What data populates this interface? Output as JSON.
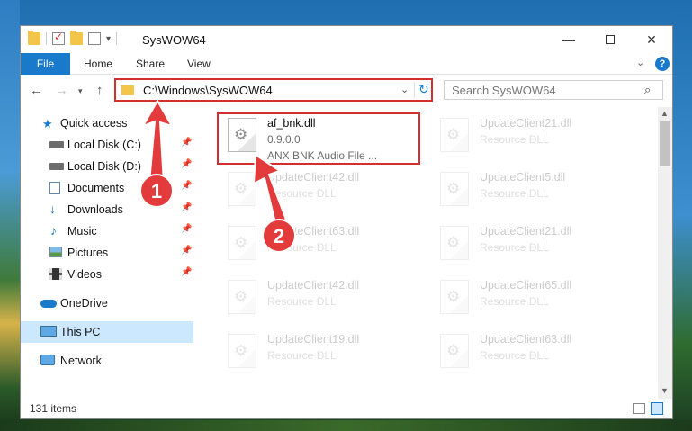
{
  "window": {
    "title": "SysWOW64",
    "controls": {
      "minimize": "—",
      "maximize": "",
      "close": "✕"
    }
  },
  "ribbon": {
    "tabs": [
      "File",
      "Home",
      "Share",
      "View"
    ],
    "help": "?"
  },
  "address": {
    "path": "C:\\Windows\\SysWOW64",
    "search_placeholder": "Search SysWOW64"
  },
  "sidebar": {
    "items": [
      {
        "label": "Quick access",
        "icon": "star-icon"
      },
      {
        "label": "Local Disk (C:)",
        "icon": "drive-icon",
        "pinned": true
      },
      {
        "label": "Local Disk (D:)",
        "icon": "drive-icon",
        "pinned": true
      },
      {
        "label": "Documents",
        "icon": "documents-icon",
        "pinned": true
      },
      {
        "label": "Downloads",
        "icon": "download-icon",
        "pinned": true
      },
      {
        "label": "Music",
        "icon": "music-icon",
        "pinned": true
      },
      {
        "label": "Pictures",
        "icon": "pictures-icon",
        "pinned": true
      },
      {
        "label": "Videos",
        "icon": "videos-icon",
        "pinned": true
      },
      {
        "label": "OneDrive",
        "icon": "cloud-icon"
      },
      {
        "label": "This PC",
        "icon": "computer-icon",
        "selected": true
      },
      {
        "label": "Network",
        "icon": "network-icon"
      }
    ]
  },
  "files": [
    {
      "name": "af_bnk.dll",
      "version": "0.9.0.0",
      "desc": "ANX BNK Audio File ..."
    },
    {
      "name": "UpdateClient21.dll",
      "desc": "Resource DLL"
    },
    {
      "name": "UpdateClient42.dll",
      "desc": "Resource DLL"
    },
    {
      "name": "UpdateClient5.dll",
      "desc": "Resource DLL"
    },
    {
      "name": "UpdateClient63.dll",
      "desc": "Resource DLL"
    },
    {
      "name": "UpdateClient21.dll",
      "desc": "Resource DLL"
    },
    {
      "name": "UpdateClient42.dll",
      "desc": "Resource DLL"
    },
    {
      "name": "UpdateClient65.dll",
      "desc": "Resource DLL"
    },
    {
      "name": "UpdateClient19.dll",
      "desc": "Resource DLL"
    },
    {
      "name": "UpdateClient63.dll",
      "desc": "Resource DLL"
    }
  ],
  "status": {
    "items": "131 items"
  },
  "annotations": {
    "marker1": "1",
    "marker2": "2"
  },
  "colors": {
    "accent": "#1979ca",
    "highlight": "#d32f2f"
  }
}
